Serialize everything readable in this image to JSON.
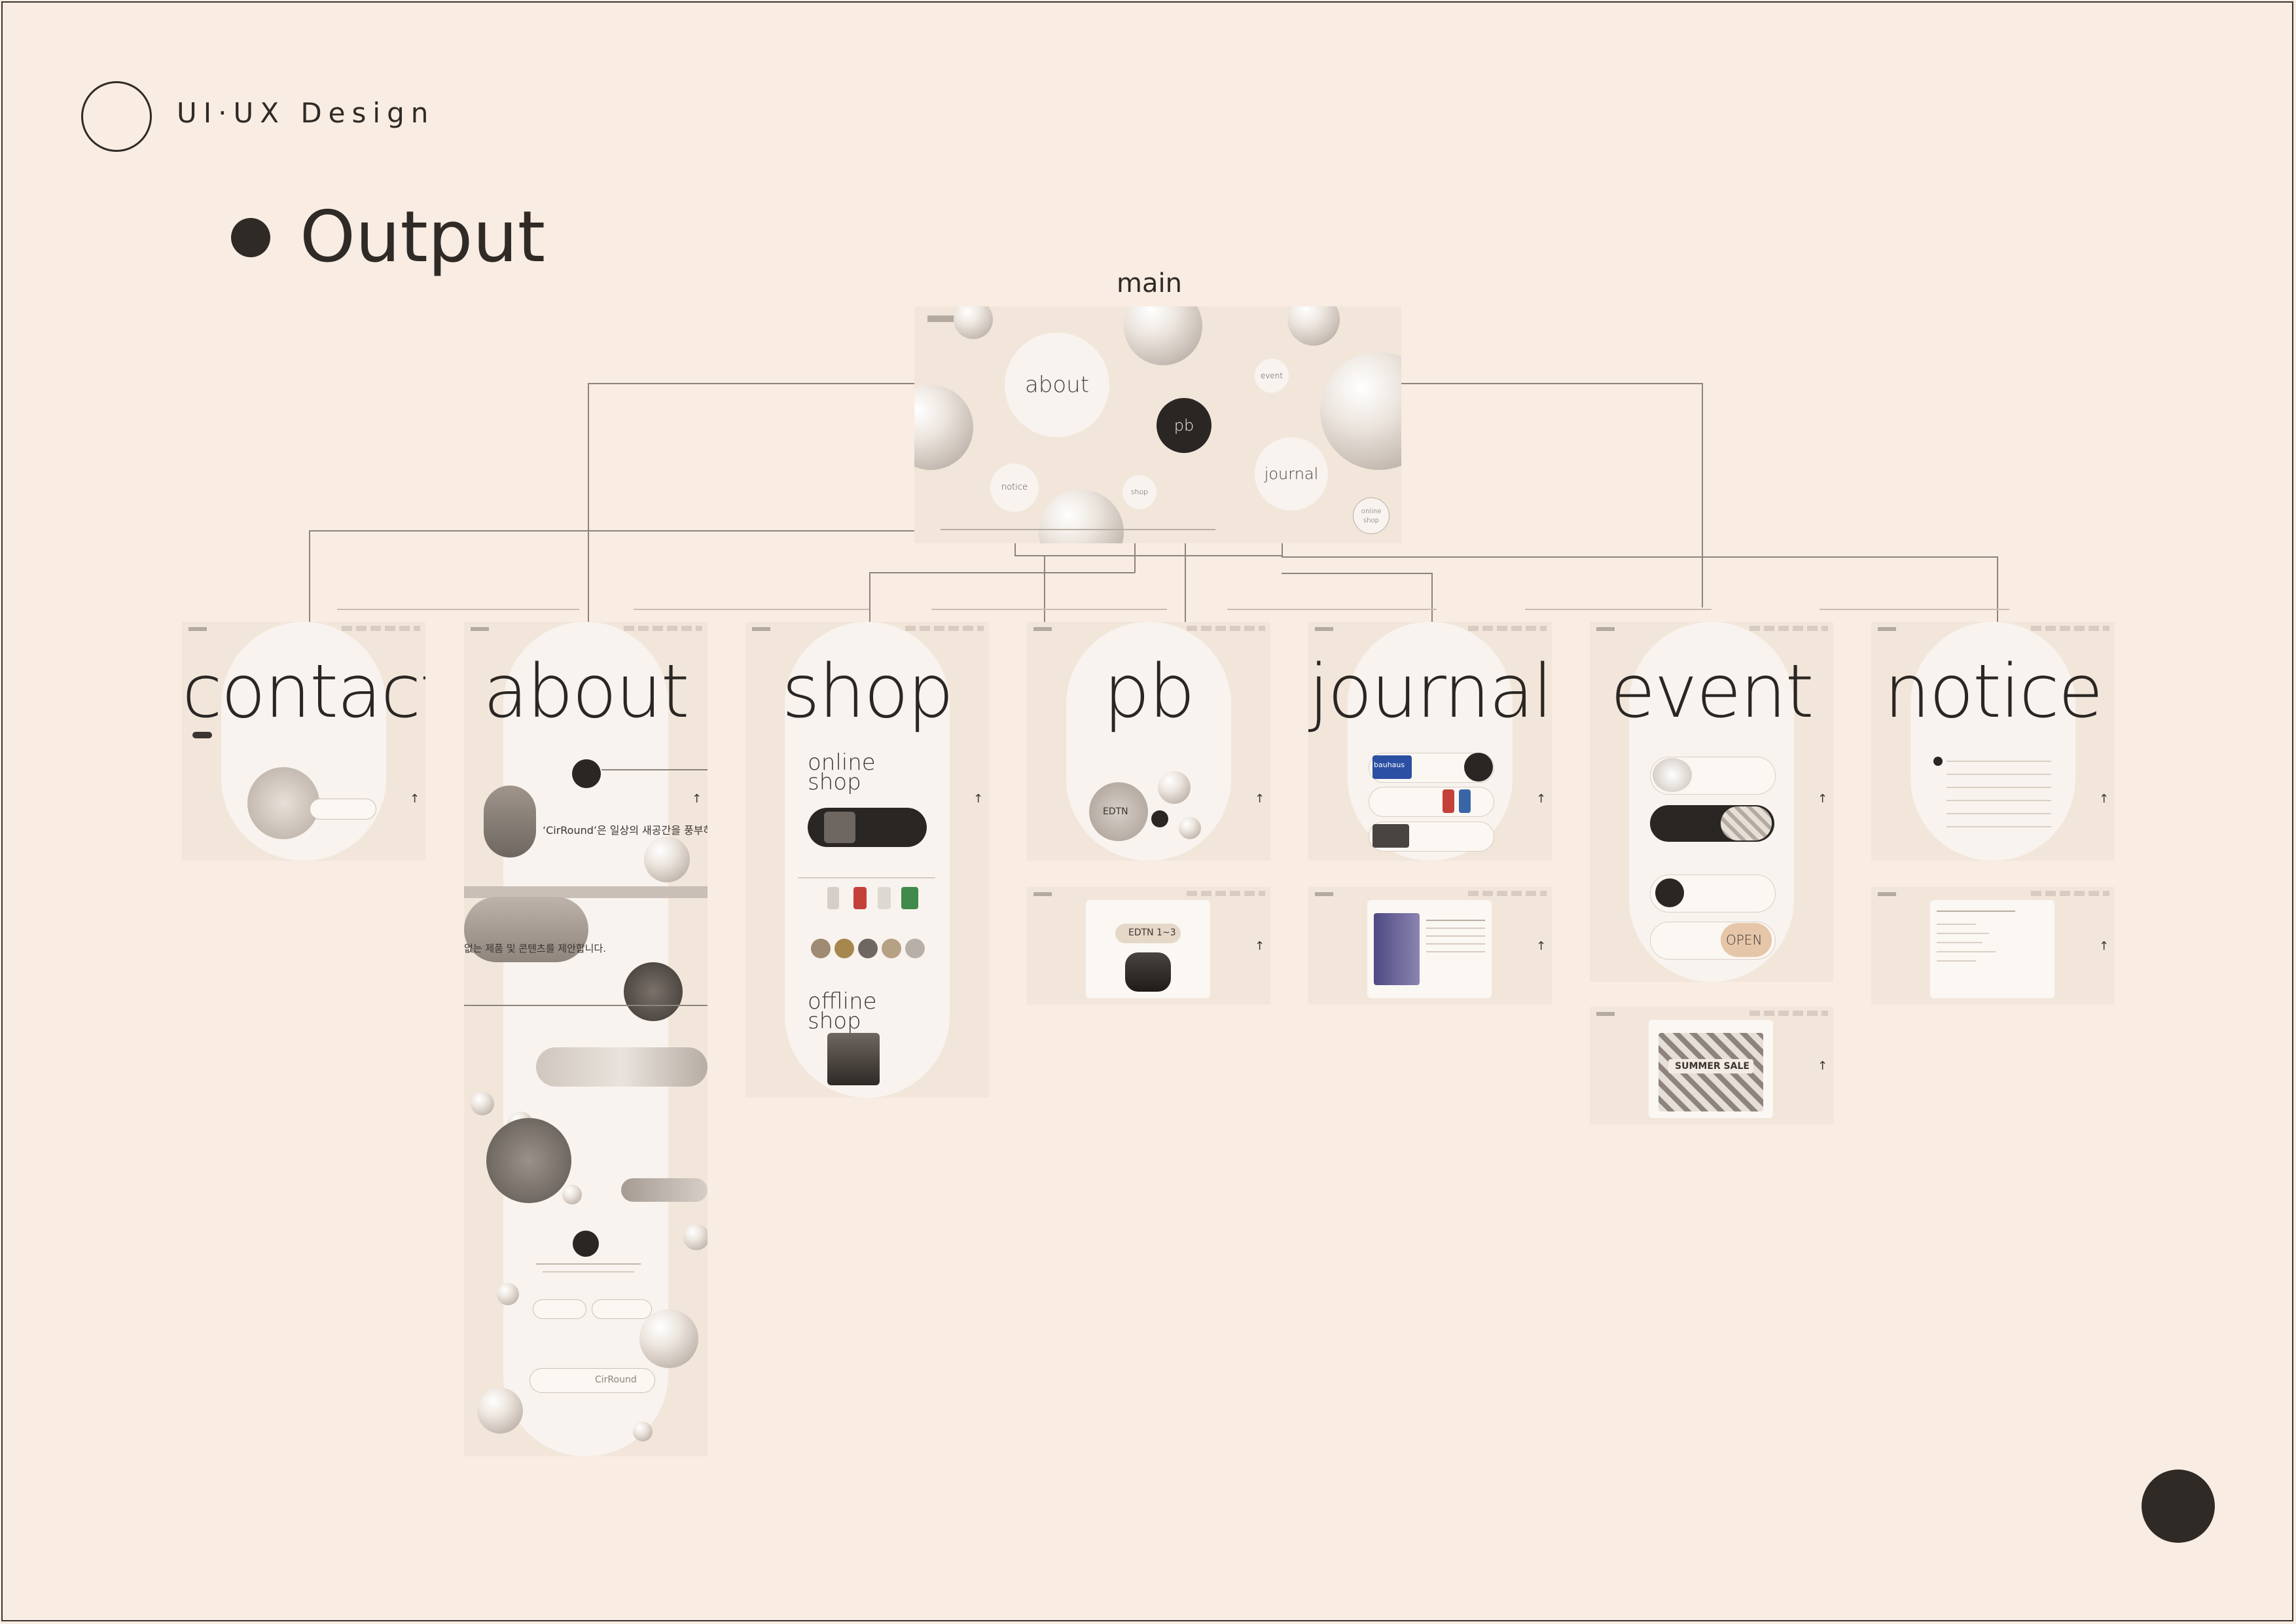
{
  "header": {
    "brand": "UI·UX Design",
    "title": "Output"
  },
  "main_screen": {
    "caption": "main",
    "menu": {
      "about": "about",
      "pb": "pb",
      "journal": "journal",
      "event": "event",
      "notice": "notice",
      "shop": "shop",
      "online_shop": "online shop"
    }
  },
  "pages": [
    {
      "name": "contact"
    },
    {
      "name": "about"
    },
    {
      "name": "shop"
    },
    {
      "name": "pb"
    },
    {
      "name": "journal"
    },
    {
      "name": "event"
    },
    {
      "name": "notice"
    }
  ],
  "details": {
    "about_brand": "CirRound",
    "about_line1": "‘CirRound’은 일상의 새공간을 풍부하게 표현",
    "about_line2": "없는 제품 및 콘텐츠를 제안합니다.",
    "shop_online": "online shop",
    "shop_offline": "offline shop",
    "pb_edtn": "EDTN",
    "pb_edtn_range": "EDTN 1~3",
    "journal_brand": "bauhaus",
    "event_open": "OPEN",
    "event_sale": "SUMMER SALE"
  },
  "colors": {
    "background": "#f9ece2",
    "ink": "#2f2a26",
    "panel": "#f2e6da",
    "card": "#f8f3ee"
  }
}
